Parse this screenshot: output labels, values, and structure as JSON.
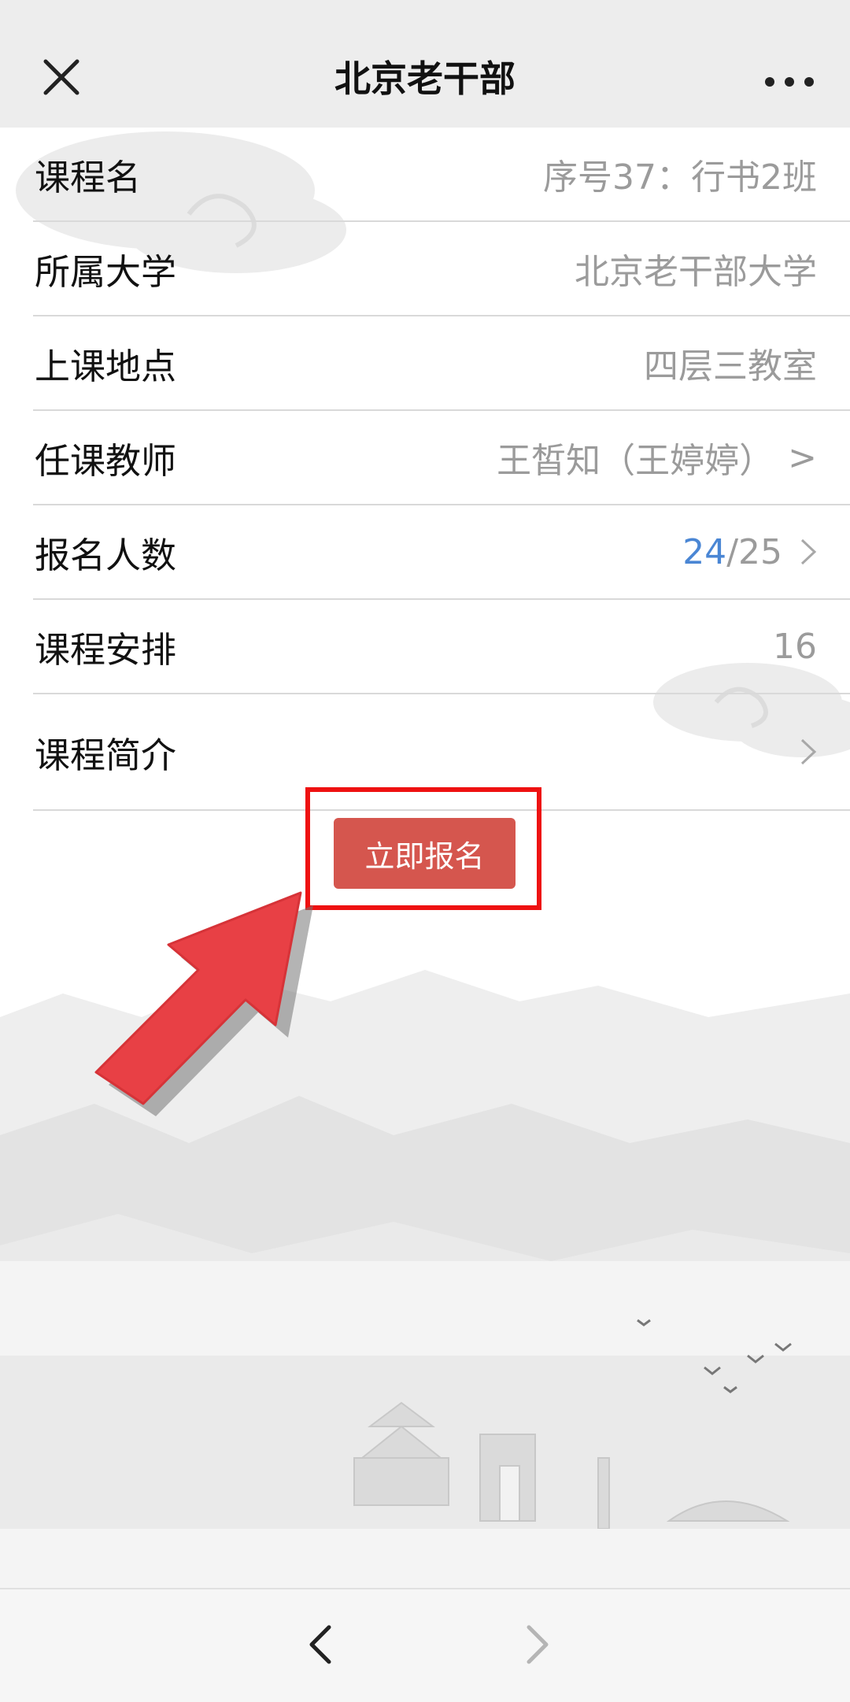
{
  "nav": {
    "title": "北京老干部",
    "close_icon": "close-icon",
    "more_icon": "more-dots-icon"
  },
  "course": {
    "rows": [
      {
        "label": "课程名",
        "value": "序号37：行书2班"
      },
      {
        "label": "所属大学",
        "value": "北京老干部大学"
      },
      {
        "label": "上课地点",
        "value": "四层三教室"
      },
      {
        "label": "任课教师",
        "value": "王皙知（王婷婷）",
        "suffix": ">"
      },
      {
        "label": "报名人数",
        "enrolled": "24",
        "capacity": "/25",
        "icon": "chevron-right-icon"
      },
      {
        "label": "课程安排",
        "value": "16"
      },
      {
        "label": "课程简介",
        "value": "",
        "icon": "chevron-right-icon"
      }
    ]
  },
  "enroll": {
    "label": "立即报名"
  },
  "toolbar": {
    "back_icon": "back-arrow-icon",
    "forward_icon": "forward-arrow-icon"
  },
  "colors": {
    "enroll_button": "#d5564e",
    "highlight_box": "#ee1111",
    "arrow": "#e84045",
    "enrolled_count": "#4a86d4"
  }
}
